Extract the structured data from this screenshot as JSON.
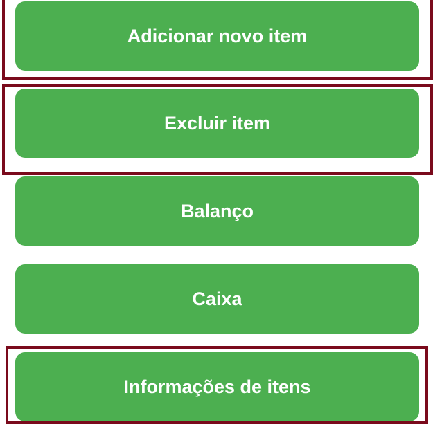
{
  "menu": {
    "items": [
      {
        "label": "Adicionar novo item",
        "highlighted": true
      },
      {
        "label": "Excluir item",
        "highlighted": true
      },
      {
        "label": "Balanço",
        "highlighted": false
      },
      {
        "label": "Caixa",
        "highlighted": false
      },
      {
        "label": "Informações de itens",
        "highlighted": true
      }
    ]
  },
  "colors": {
    "button_background": "#4caf50",
    "button_text": "#ffffff",
    "highlight_border": "#7a0a1c",
    "page_background": "#ffffff"
  }
}
